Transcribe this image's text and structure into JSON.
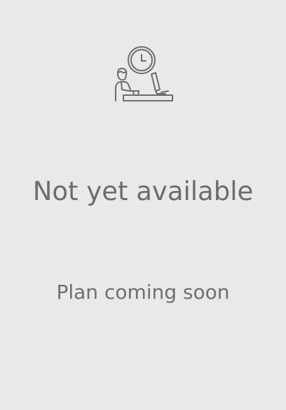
{
  "empty_state": {
    "illustration_icon": "person-at-desk-waiting-clock-icon",
    "headline": "Not yet available",
    "subtext": "Plan coming soon"
  },
  "colors": {
    "background": "#e9e9e9",
    "text": "#6d6d6d",
    "icon_stroke": "#6d6d6d"
  }
}
